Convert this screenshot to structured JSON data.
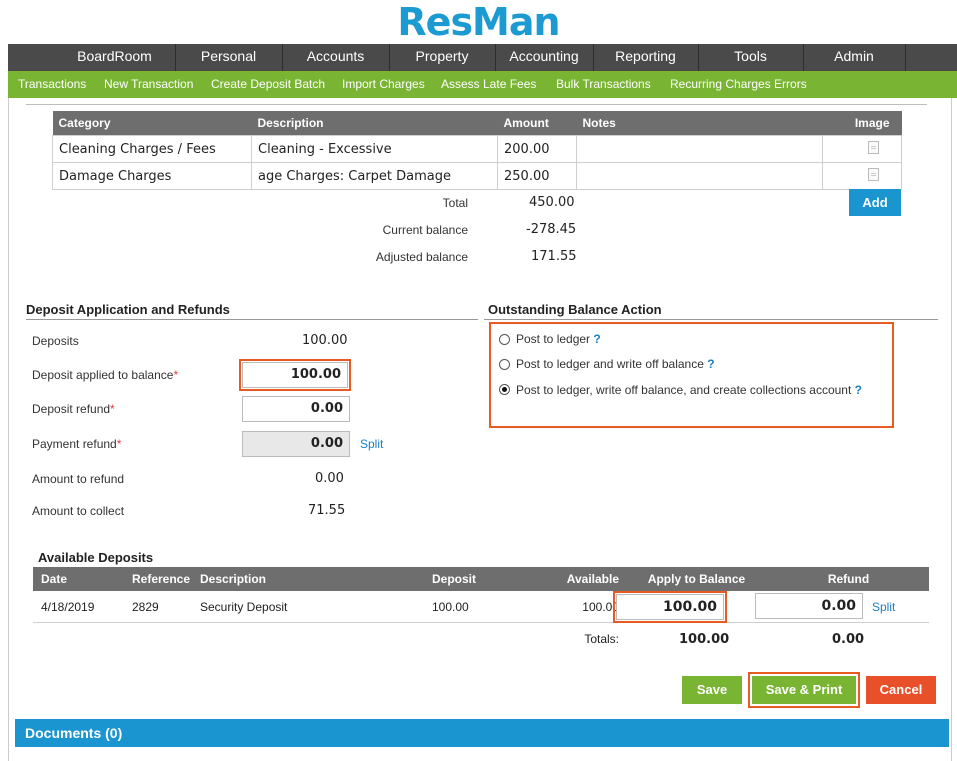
{
  "app": {
    "logo": "ResMan"
  },
  "main_nav": [
    "BoardRoom",
    "Personal",
    "Accounts",
    "Property",
    "Accounting",
    "Reporting",
    "Tools",
    "Admin"
  ],
  "sub_nav": [
    "Transactions",
    "New Transaction",
    "Create Deposit Batch",
    "Import Charges",
    "Assess Late Fees",
    "Bulk Transactions",
    "Recurring Charges Errors"
  ],
  "charges": {
    "headers": {
      "category": "Category",
      "description": "Description",
      "amount": "Amount",
      "notes": "Notes",
      "image": "Image"
    },
    "rows": [
      {
        "category": "Cleaning Charges / Fees",
        "description": "Cleaning - Excessive",
        "amount": "200.00",
        "notes": ""
      },
      {
        "category": "Damage Charges",
        "description": "age Charges: Carpet Damage",
        "amount": "250.00",
        "notes": ""
      }
    ],
    "add_label": "Add",
    "total_label": "Total",
    "total": "450.00",
    "current_balance_label": "Current balance",
    "current_balance": "-278.45",
    "adjusted_balance_label": "Adjusted balance",
    "adjusted_balance": "171.55"
  },
  "deposit_app": {
    "title": "Deposit Application and Refunds",
    "deposits_label": "Deposits",
    "deposits": "100.00",
    "applied_label": "Deposit applied to balance",
    "applied": "100.00",
    "deposit_refund_label": "Deposit refund",
    "deposit_refund": "0.00",
    "payment_refund_label": "Payment refund",
    "payment_refund": "0.00",
    "split_label": "Split",
    "amount_to_refund_label": "Amount to refund",
    "amount_to_refund": "0.00",
    "amount_to_collect_label": "Amount to collect",
    "amount_to_collect": "71.55",
    "required_mark": "*"
  },
  "outstanding": {
    "title": "Outstanding Balance Action",
    "options": [
      "Post to ledger",
      "Post to ledger and write off balance",
      "Post to ledger, write off balance, and create collections account"
    ],
    "selected": 2,
    "help": "?"
  },
  "available_deposits": {
    "title": "Available Deposits",
    "headers": {
      "date": "Date",
      "reference": "Reference",
      "description": "Description",
      "deposit": "Deposit",
      "available": "Available",
      "apply": "Apply to Balance",
      "refund": "Refund"
    },
    "rows": [
      {
        "date": "4/18/2019",
        "reference": "2829",
        "description": "Security Deposit",
        "deposit": "100.00",
        "available": "100.00",
        "apply": "100.00",
        "refund": "0.00",
        "split": "Split"
      }
    ],
    "totals_label": "Totals:",
    "total_apply": "100.00",
    "total_refund": "0.00"
  },
  "actions": {
    "save": "Save",
    "save_print": "Save & Print",
    "cancel": "Cancel"
  },
  "documents": {
    "title": "Documents (0)"
  },
  "colors": {
    "brand_blue": "#1a95d0",
    "nav_green": "#79b533",
    "nav_dark": "#4a4a4a",
    "highlight_orange": "#e85b22",
    "cancel_red": "#e8502a",
    "save_green": "#79b533"
  }
}
